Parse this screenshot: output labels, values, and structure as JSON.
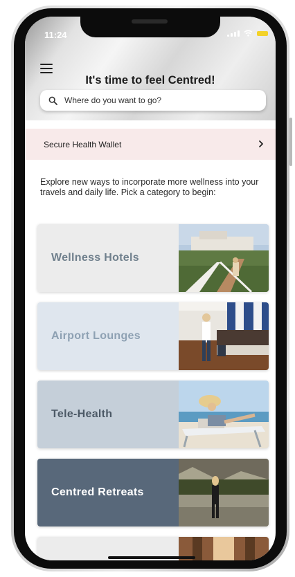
{
  "status_bar": {
    "time": "11:24",
    "battery_color": "#f3d22a"
  },
  "header": {
    "title": "It's time to feel Centred!",
    "search_placeholder": "Where do you want to go?"
  },
  "wallet": {
    "label": "Secure Health Wallet"
  },
  "intro_text": "Explore new ways to incorporate more wellness into your travels and daily life. Pick a category to begin:",
  "categories": [
    {
      "label": "Wellness Hotels",
      "bg": "#ececec",
      "text_color": "#6f7f8c",
      "image": "hotel-boardwalk-photo"
    },
    {
      "label": "Airport Lounges",
      "bg": "#dfe6ee",
      "text_color": "#8ea1b3",
      "image": "airport-lounge-photo"
    },
    {
      "label": "Tele-Health",
      "bg": "#c5cfd9",
      "text_color": "#4c5966",
      "image": "beach-laptop-photo"
    },
    {
      "label": "Centred Retreats",
      "bg": "#58687a",
      "text_color": "#ffffff",
      "image": "lake-retreat-photo"
    },
    {
      "label": "",
      "bg": "#ececec",
      "text_color": "#6f7f8c",
      "image": "forest-photo"
    }
  ],
  "colors": {
    "wallet_bg": "#f8eaea",
    "accent_dark": "#58687a"
  }
}
